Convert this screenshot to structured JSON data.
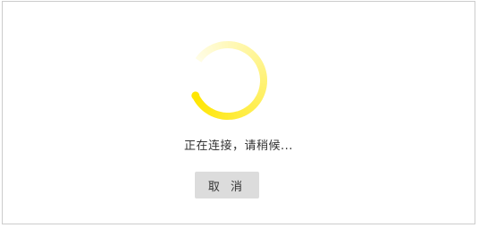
{
  "dialog": {
    "status_text": "正在连接，请稍候...",
    "cancel_label": "取 消"
  },
  "spinner": {
    "icon": "loading-spinner-icon",
    "color_head": "#FFE600",
    "color_tail": "#FFFDE8"
  }
}
